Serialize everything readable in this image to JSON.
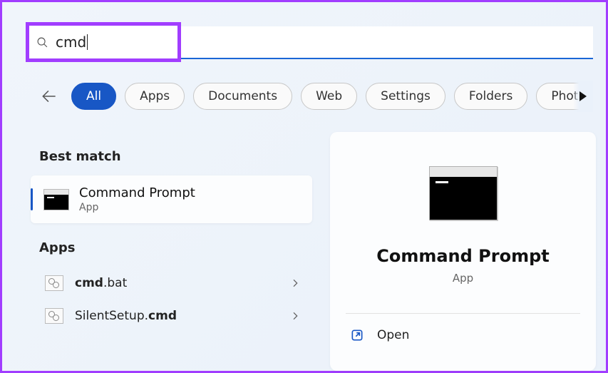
{
  "search": {
    "query": "cmd"
  },
  "filters": {
    "items": [
      "All",
      "Apps",
      "Documents",
      "Web",
      "Settings",
      "Folders",
      "Photos"
    ],
    "active_index": 0
  },
  "sections": {
    "best_match_heading": "Best match",
    "apps_heading": "Apps"
  },
  "best_match": {
    "title": "Command Prompt",
    "subtitle": "App"
  },
  "apps": [
    {
      "prefix": "cmd",
      "suffix": ".bat"
    },
    {
      "prefix": "SilentSetup.",
      "suffix": "cmd"
    }
  ],
  "detail": {
    "title": "Command Prompt",
    "subtitle": "App",
    "actions": {
      "open": "Open"
    }
  }
}
